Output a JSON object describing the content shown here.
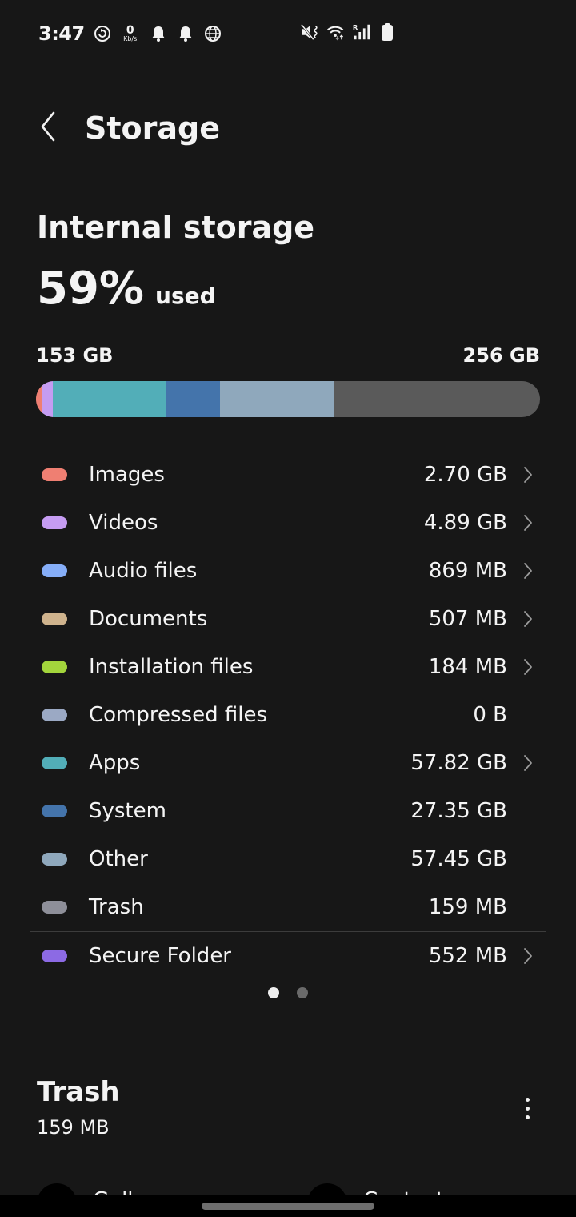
{
  "status_bar": {
    "time": "3:47",
    "net_speed_value": "0",
    "net_speed_unit": "Kb/s",
    "icons_left": [
      "sync-icon",
      "network-speed",
      "notification-bell-icon",
      "notification-bell-icon",
      "globe-icon"
    ],
    "icons_right": [
      "mute-vibrate-icon",
      "wifi-icon",
      "roaming-signal-icon",
      "battery-icon"
    ],
    "roaming_label": "R"
  },
  "header": {
    "back_icon": "chevron-left-icon",
    "title": "Storage"
  },
  "internal_storage": {
    "title": "Internal storage",
    "percent_used": "59%",
    "used_suffix": "used",
    "used_label": "153 GB",
    "total_label": "256 GB",
    "bar": {
      "total_gb": 256,
      "free_color": "#5a5a5a",
      "segments": [
        {
          "name": "Images",
          "fraction": 0.011,
          "color": "#ef7f72"
        },
        {
          "name": "Videos",
          "fraction": 0.022,
          "color": "#c59cf2"
        },
        {
          "name": "Apps",
          "fraction": 0.226,
          "color": "#52aeb8"
        },
        {
          "name": "System",
          "fraction": 0.107,
          "color": "#4474ab"
        },
        {
          "name": "Other",
          "fraction": 0.227,
          "color": "#8fa8bc"
        }
      ]
    }
  },
  "categories": [
    {
      "label": "Images",
      "value": "2.70 GB",
      "color": "#ef7f72",
      "has_chevron": true
    },
    {
      "label": "Videos",
      "value": "4.89 GB",
      "color": "#c59cf2",
      "has_chevron": true
    },
    {
      "label": "Audio files",
      "value": "869 MB",
      "color": "#86aef8",
      "has_chevron": true
    },
    {
      "label": "Documents",
      "value": "507 MB",
      "color": "#cfb38d",
      "has_chevron": true
    },
    {
      "label": "Installation files",
      "value": "184 MB",
      "color": "#a3d53c",
      "has_chevron": true
    },
    {
      "label": "Compressed files",
      "value": "0 B",
      "color": "#9ba9c4",
      "has_chevron": false
    },
    {
      "label": "Apps",
      "value": "57.82 GB",
      "color": "#52aeb8",
      "has_chevron": true
    },
    {
      "label": "System",
      "value": "27.35 GB",
      "color": "#4474ab",
      "has_chevron": false
    },
    {
      "label": "Other",
      "value": "57.45 GB",
      "color": "#8fa8bc",
      "has_chevron": false
    },
    {
      "label": "Trash",
      "value": "159 MB",
      "color": "#8e8f99",
      "has_chevron": false
    }
  ],
  "secure_folder": {
    "label": "Secure Folder",
    "value": "552 MB",
    "color": "#8c6ae4",
    "has_chevron": true
  },
  "pager": {
    "pages": 2,
    "active": 0,
    "active_color": "#eeeeee",
    "inactive_color": "#6a6a6a"
  },
  "trash_card": {
    "title": "Trash",
    "size": "159 MB",
    "items": [
      {
        "label": "Gallery"
      },
      {
        "label": "Contacts"
      }
    ]
  }
}
